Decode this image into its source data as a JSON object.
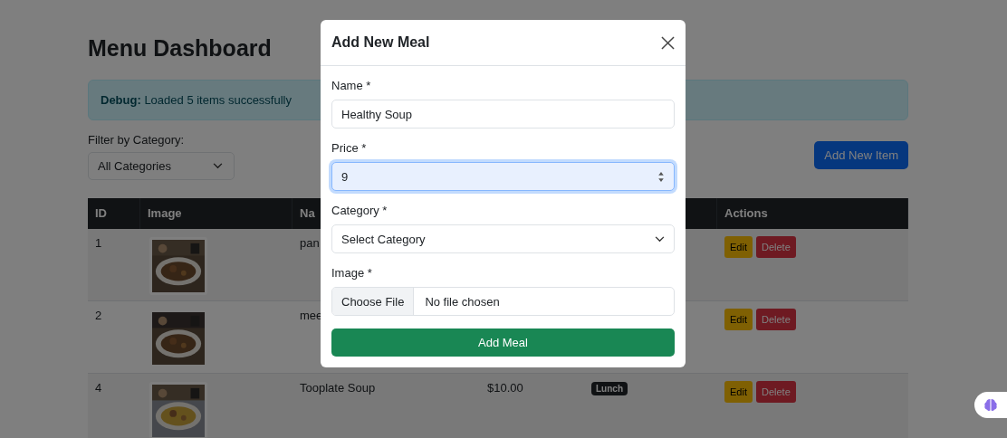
{
  "page": {
    "title": "Menu Dashboard",
    "alert": "**Debug:** Loaded 5 items successfully",
    "filter": {
      "label": "Filter by Category:",
      "value": "All Categories"
    },
    "add_button": "Add New Item"
  },
  "table": {
    "columns": [
      "ID",
      "Image",
      "Na",
      "Actions"
    ],
    "rows": [
      {
        "id": "1",
        "name": "pan",
        "actions": [
          "Edit",
          "Delete"
        ]
      },
      {
        "id": "2",
        "name": "mee",
        "actions": [
          "Edit",
          "Delete"
        ]
      },
      {
        "id": "4",
        "name": "Tooplate Soup",
        "price": "$10.00",
        "category": "Lunch",
        "actions": [
          "Edit",
          "Delete"
        ]
      }
    ]
  },
  "modal": {
    "title": "Add New Meal",
    "fields": [
      {
        "kind": "text",
        "label": "Name *",
        "value": "Healthy Soup",
        "focused": false
      },
      {
        "kind": "number",
        "label": "Price *",
        "value": "9",
        "focused": true
      },
      {
        "kind": "select",
        "label": "Category *",
        "value": "Select Category",
        "focused": false
      },
      {
        "kind": "file",
        "label": "Image *",
        "button": "Choose File",
        "value": "No file chosen",
        "focused": false
      }
    ],
    "submit": "Add Meal"
  }
}
